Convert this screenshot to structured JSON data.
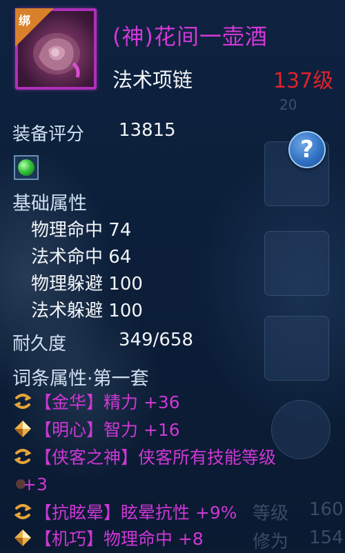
{
  "item": {
    "badge": "绑",
    "name": "(神)花间一壶酒",
    "type": "法术项链",
    "level": "137级"
  },
  "score": {
    "label": "装备评分",
    "value": "13815"
  },
  "help_icon": "question-icon",
  "base": {
    "title": "基础属性",
    "attrs": [
      {
        "name": "物理命中",
        "value": "74"
      },
      {
        "name": "法术命中",
        "value": "64"
      },
      {
        "name": "物理躲避",
        "value": "100"
      },
      {
        "name": "法术躲避",
        "value": "100"
      }
    ]
  },
  "durability": {
    "label": "耐久度",
    "value": "349/658"
  },
  "affix": {
    "title": "词条属性·第一套",
    "rows": [
      {
        "icon": "swirl-icon",
        "text": "【金华】精力 +36"
      },
      {
        "icon": "diamond-icon",
        "text": "【明心】智力 +16"
      },
      {
        "icon": "swirl-icon",
        "text": "【侠客之神】侠客所有技能等级"
      },
      {
        "icon": "dot-icon",
        "text": "+3"
      },
      {
        "icon": "swirl-icon",
        "text": "【抗眩晕】眩晕抗性 +9%"
      },
      {
        "icon": "diamond-icon",
        "text": "【机巧】物理命中 +8"
      }
    ]
  },
  "background": {
    "ghost_level_label": "等级",
    "ghost_level_value": "160",
    "ghost_cult_label": "修为",
    "ghost_cult_value": "154",
    "ghost_small": "20"
  },
  "colors": {
    "name": "#d338d8",
    "level": "#e2212b",
    "affix": "#cd38d5",
    "badge": "#d9812a"
  }
}
